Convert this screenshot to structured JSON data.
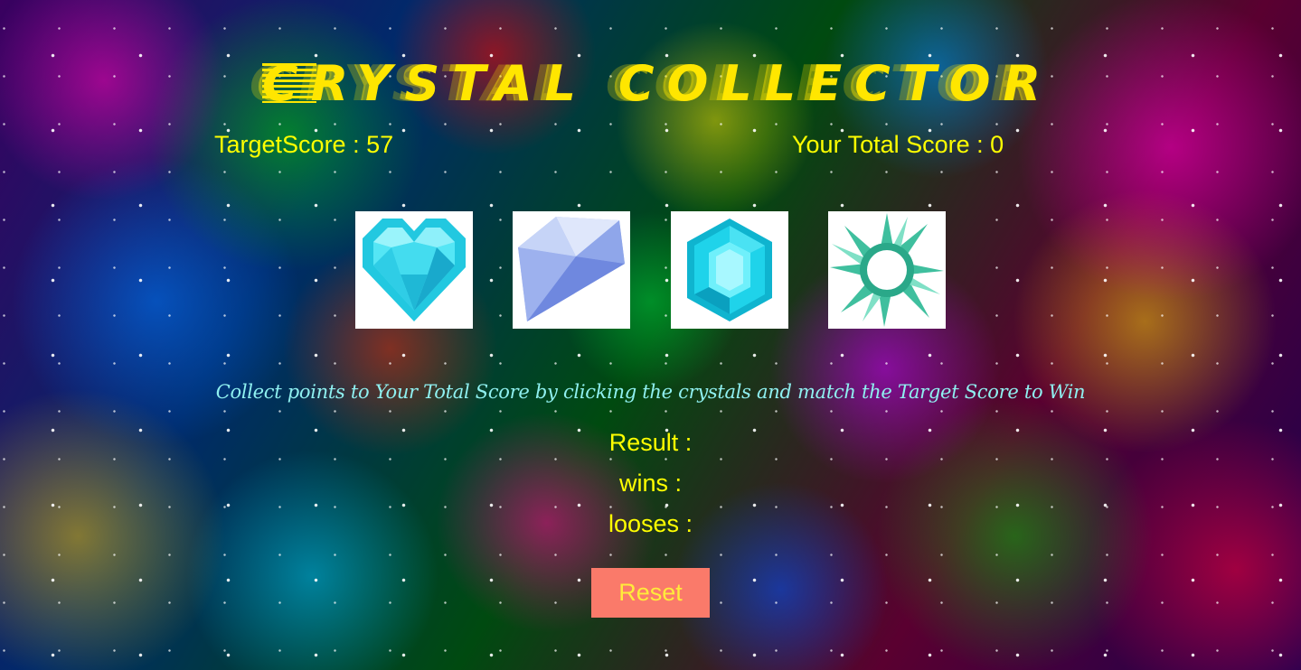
{
  "title": "CRYSTAL COLLECTOR",
  "target": {
    "label": "TargetScore : ",
    "value": "57"
  },
  "total": {
    "label": "Your Total Score : ",
    "value": "0"
  },
  "crystals": [
    {
      "icon": "heart-crystal-icon"
    },
    {
      "icon": "diamond-crystal-icon"
    },
    {
      "icon": "hexagon-gem-icon"
    },
    {
      "icon": "crystal-cluster-icon"
    }
  ],
  "instructions": "Collect points to Your Total Score by clicking the crystals and match the Target Score to Win",
  "result": {
    "label": "Result : ",
    "value": ""
  },
  "wins": {
    "label": "wins : ",
    "value": ""
  },
  "losses": {
    "label": "looses : ",
    "value": ""
  },
  "reset_label": "Reset",
  "colors": {
    "text": "#ffff00",
    "instructions": "#8ff0f0",
    "reset_bg": "#fa7a6a",
    "reset_text": "#ffeb3b"
  }
}
